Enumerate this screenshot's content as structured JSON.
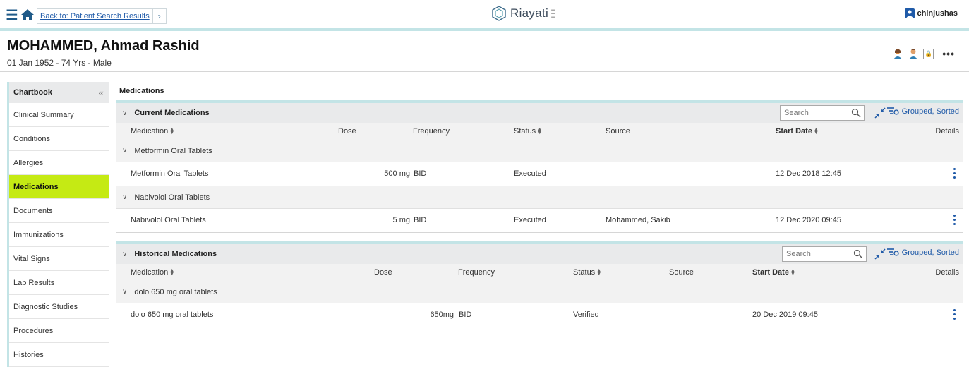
{
  "topbar": {
    "back_label": "Back to: Patient Search Results",
    "brand": "Riayati",
    "username": "chinjushas"
  },
  "patient": {
    "name": "MOHAMMED, Ahmad Rashid",
    "demographics": "01 Jan 1952 - 74 Yrs - Male"
  },
  "sidebar": {
    "title": "Chartbook",
    "items": [
      {
        "label": "Clinical Summary"
      },
      {
        "label": "Conditions"
      },
      {
        "label": "Allergies"
      },
      {
        "label": "Medications"
      },
      {
        "label": "Documents"
      },
      {
        "label": "Immunizations"
      },
      {
        "label": "Vital Signs"
      },
      {
        "label": "Lab Results"
      },
      {
        "label": "Diagnostic Studies"
      },
      {
        "label": "Procedures"
      },
      {
        "label": "Histories"
      }
    ],
    "active_index": 3
  },
  "main": {
    "title": "Medications",
    "search_placeholder": "Search",
    "grouped_label": "Grouped, Sorted",
    "columns": {
      "medication": "Medication",
      "dose": "Dose",
      "frequency": "Frequency",
      "status": "Status",
      "source": "Source",
      "start_date": "Start Date",
      "details": "Details"
    },
    "current": {
      "title": "Current Medications",
      "groups": [
        {
          "name": "Metformin Oral Tablets",
          "row": {
            "medication": "Metformin Oral Tablets",
            "dose": "500 mg",
            "frequency": "BID",
            "status": "Executed",
            "source": "",
            "start_date": "12 Dec 2018 12:45"
          }
        },
        {
          "name": "Nabivolol Oral Tablets",
          "row": {
            "medication": "Nabivolol Oral Tablets",
            "dose": "5 mg",
            "frequency": "BID",
            "status": "Executed",
            "source": "Mohammed, Sakib",
            "start_date": "12 Dec 2020 09:45"
          }
        }
      ]
    },
    "historical": {
      "title": "Historical Medications",
      "groups": [
        {
          "name": "dolo 650 mg oral tablets",
          "row": {
            "medication": "dolo 650 mg oral tablets",
            "dose": "650mg",
            "frequency": "BID",
            "status": "Verified",
            "source": "",
            "start_date": "20 Dec 2019 09:45"
          }
        }
      ]
    }
  },
  "colors": {
    "accent": "#c3e4e6",
    "link": "#1f5aa8",
    "active_nav": "#c5ea14",
    "header_gray": "#e9eaeb"
  }
}
